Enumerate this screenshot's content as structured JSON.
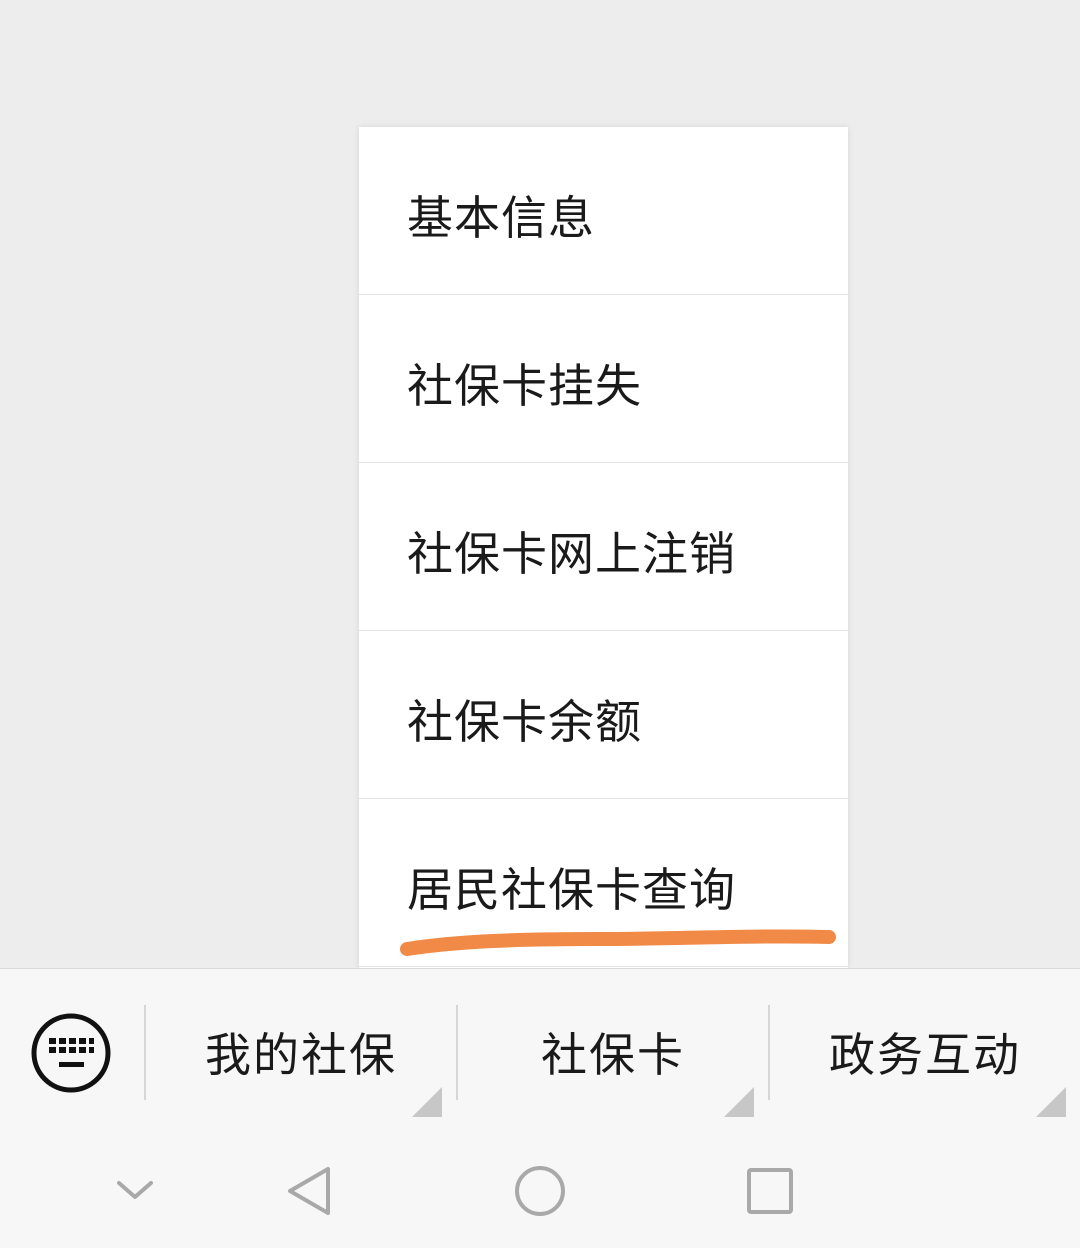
{
  "popup_menu": {
    "items": [
      {
        "label": "基本信息"
      },
      {
        "label": "社保卡挂失"
      },
      {
        "label": "社保卡网上注销"
      },
      {
        "label": "社保卡余额"
      },
      {
        "label": "居民社保卡查询",
        "highlighted": true
      }
    ],
    "highlight_color": "#f08a46"
  },
  "menu_bar": {
    "keyboard_icon": "keyboard-icon",
    "menus": [
      {
        "label": "我的社保"
      },
      {
        "label": "社保卡"
      },
      {
        "label": "政务互动"
      }
    ]
  },
  "nav_bar": {
    "buttons": [
      {
        "icon": "chevron-down-icon"
      },
      {
        "icon": "back-triangle-icon"
      },
      {
        "icon": "home-circle-icon"
      },
      {
        "icon": "recents-square-icon"
      }
    ]
  },
  "colors": {
    "background": "#ededed",
    "bar_background": "#f7f7f7",
    "text": "#1a1a1a",
    "icon_gray": "#a9a9a9"
  }
}
